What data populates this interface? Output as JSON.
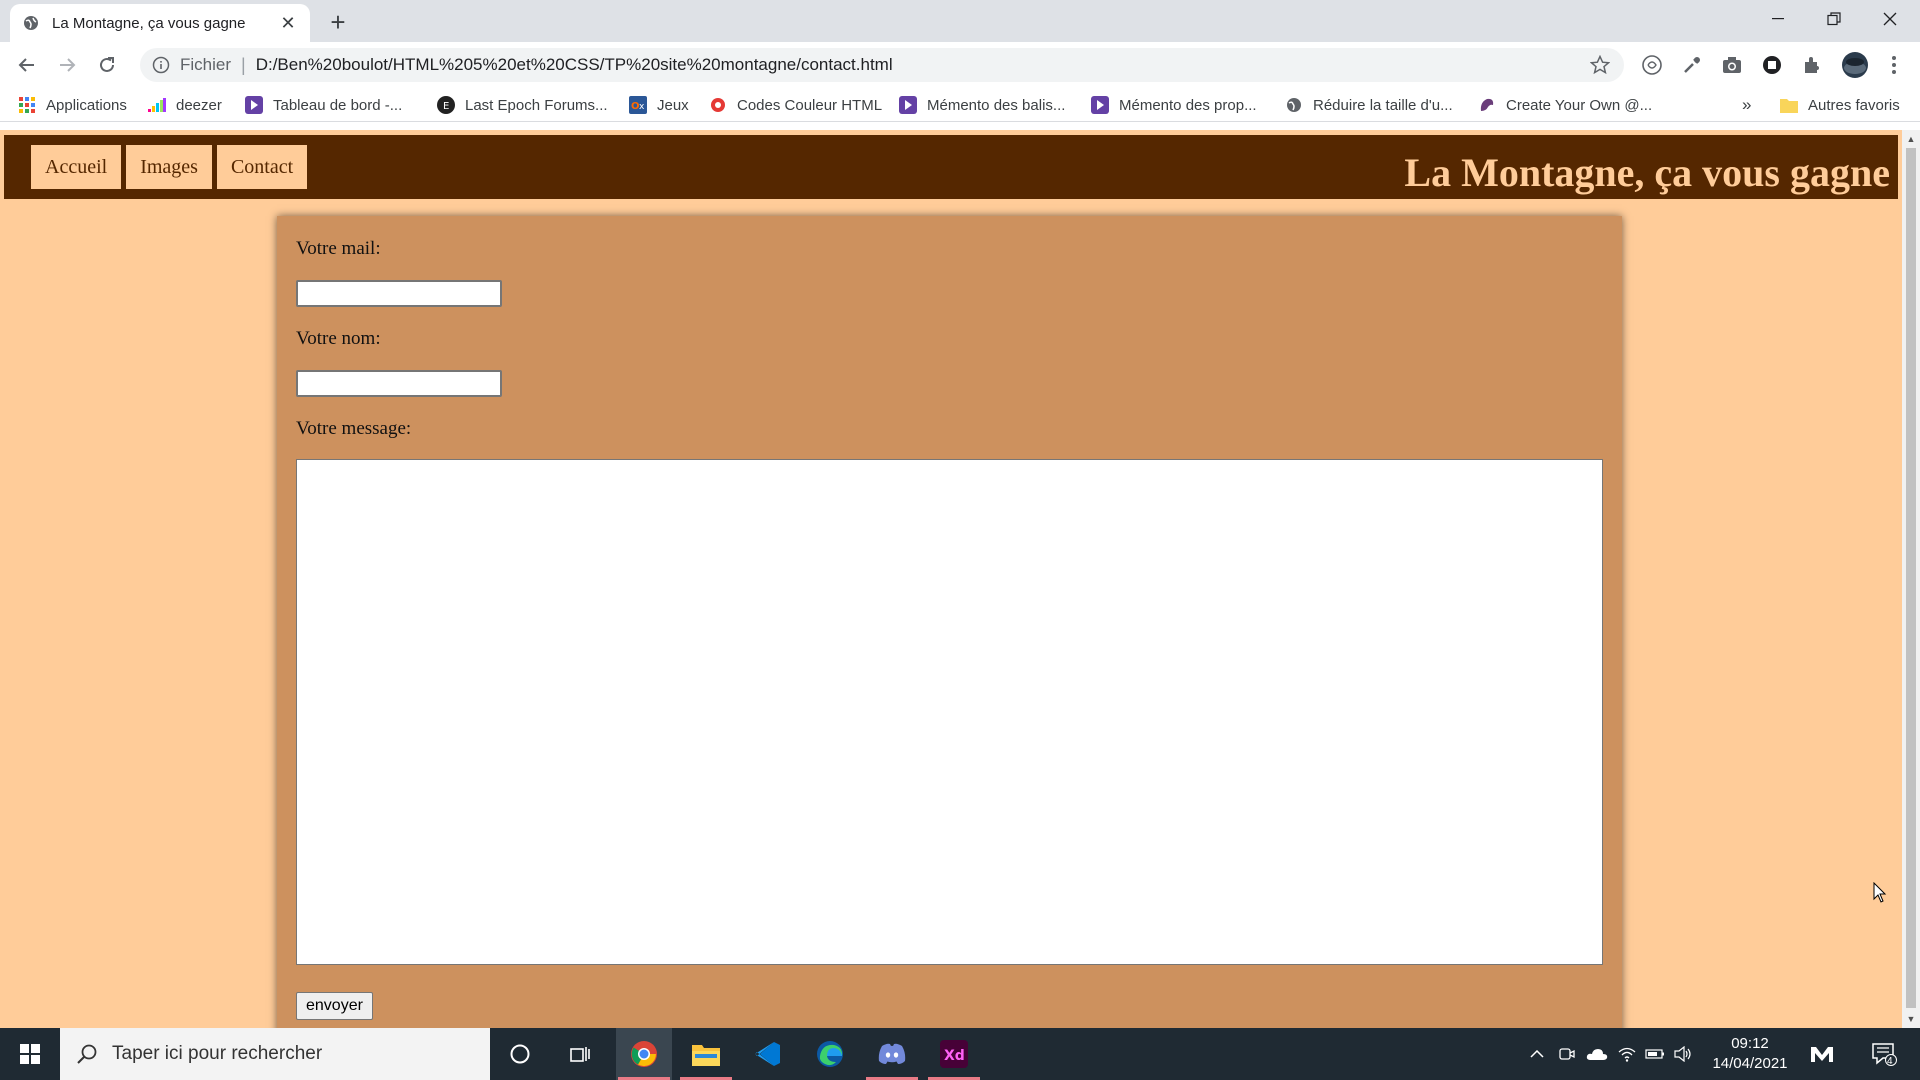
{
  "browser": {
    "tab_title": "La Montagne, ça vous gagne",
    "new_tab": "+",
    "close_tab": "✕",
    "address_scheme": "Fichier",
    "address_url": "D:/Ben%20boulot/HTML%205%20et%20CSS/TP%20site%20montagne/contact.html",
    "bookmarks": [
      {
        "label": "Applications",
        "icon": "apps-grid-icon"
      },
      {
        "label": "deezer",
        "icon": "deezer-icon"
      },
      {
        "label": "Tableau de bord -...",
        "icon": "twitch-icon"
      },
      {
        "label": "Last Epoch Forums...",
        "icon": "last-epoch-icon"
      },
      {
        "label": "Jeux",
        "icon": "games-icon"
      },
      {
        "label": "Codes Couleur HTML",
        "icon": "color-codes-icon"
      },
      {
        "label": "Mémento des balis...",
        "icon": "twitch-icon"
      },
      {
        "label": "Mémento des prop...",
        "icon": "twitch-icon"
      },
      {
        "label": "Réduire la taille d'u...",
        "icon": "globe-icon"
      },
      {
        "label": "Create Your Own @...",
        "icon": "create-icon"
      }
    ],
    "more_bookmarks": "»",
    "other_favorites": "Autres favoris"
  },
  "site": {
    "nav": [
      "Accueil",
      "Images",
      "Contact"
    ],
    "title": "La Montagne, ça vous gagne",
    "form": {
      "mail_label": "Votre mail:",
      "mail_value": "",
      "name_label": "Votre nom:",
      "name_value": "",
      "message_label": "Votre message:",
      "message_value": "",
      "submit_label": "envoyer"
    },
    "colors": {
      "header": "#552700",
      "background": "#ffcc99",
      "form": "#cd915e"
    }
  },
  "taskbar": {
    "search_placeholder": "Taper ici pour rechercher",
    "time": "09:12",
    "date": "14/04/2021",
    "notifications": "4"
  }
}
